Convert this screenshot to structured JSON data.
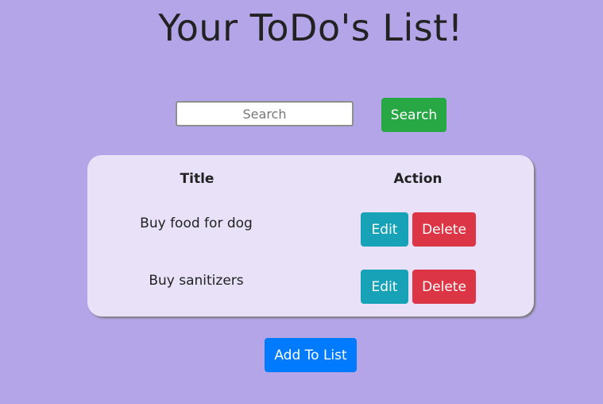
{
  "page": {
    "title": "Your ToDo's List!"
  },
  "search": {
    "placeholder": "Search",
    "value": "",
    "button_label": "Search"
  },
  "table": {
    "headers": [
      "Title",
      "Action"
    ],
    "rows": [
      {
        "title": "Buy food for dog",
        "edit_label": "Edit",
        "delete_label": "Delete"
      },
      {
        "title": "Buy sanitizers",
        "edit_label": "Edit",
        "delete_label": "Delete"
      }
    ]
  },
  "add_button": {
    "label": "Add To List"
  },
  "colors": {
    "background": "#b4a4e8",
    "card": "#e8e1f8",
    "search_button": "#28a745",
    "edit_button": "#17a2b8",
    "delete_button": "#dc3545",
    "add_button": "#007bff"
  }
}
